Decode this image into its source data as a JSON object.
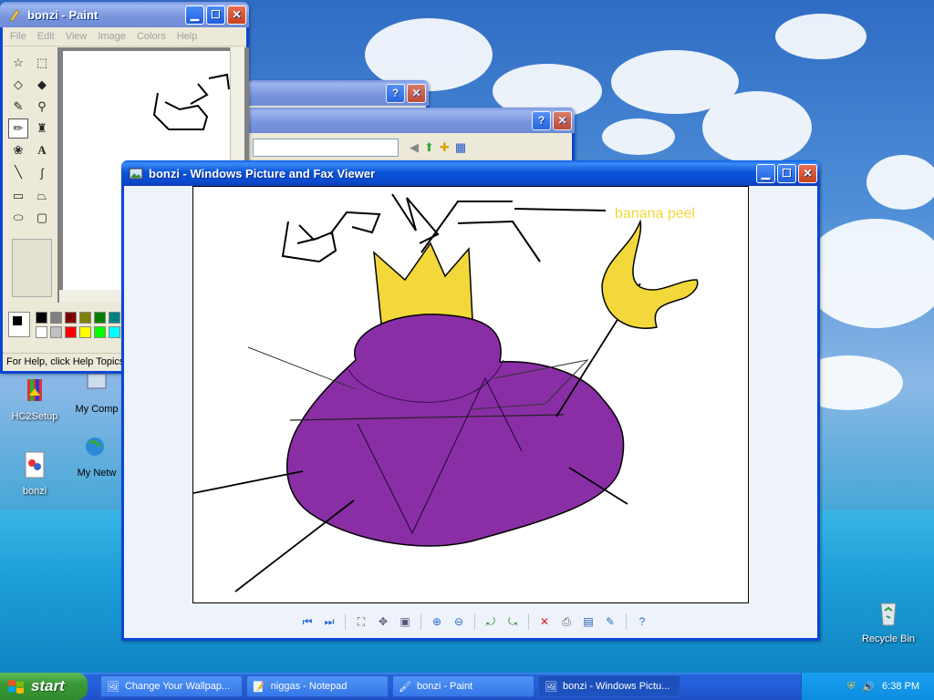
{
  "paint": {
    "title": "bonzi - Paint",
    "menu": [
      "File",
      "Edit",
      "View",
      "Image",
      "Colors",
      "Help"
    ],
    "status": "For Help, click Help Topics"
  },
  "viewer": {
    "title": "bonzi - Windows Picture and Fax Viewer",
    "image_caption": "banana peel",
    "toolbar_icons": [
      "previous-image-icon",
      "next-image-icon",
      "best-fit-icon",
      "actual-size-icon",
      "slideshow-icon",
      "zoom-in-icon",
      "zoom-out-icon",
      "rotate-clockwise-icon",
      "rotate-counterclockwise-icon",
      "delete-icon",
      "print-icon",
      "save-icon",
      "edit-icon",
      "help-icon"
    ]
  },
  "desktop": {
    "icons": [
      {
        "label": "HC2Setup"
      },
      {
        "label": "bonzi"
      },
      {
        "label": "My Comp"
      },
      {
        "label": "My Netw"
      },
      {
        "label": "Recycle Bin"
      }
    ]
  },
  "taskbar": {
    "start_label": "start",
    "items": [
      {
        "label": "Change Your Wallpap..."
      },
      {
        "label": "niggas - Notepad"
      },
      {
        "label": "bonzi - Paint"
      },
      {
        "label": "bonzi - Windows Pictu..."
      }
    ],
    "clock": "6:38 PM"
  },
  "colors": {
    "title_active": "#0a4ad0",
    "crown_yellow": "#f2d83a",
    "blob_purple": "#8a2ea6"
  }
}
